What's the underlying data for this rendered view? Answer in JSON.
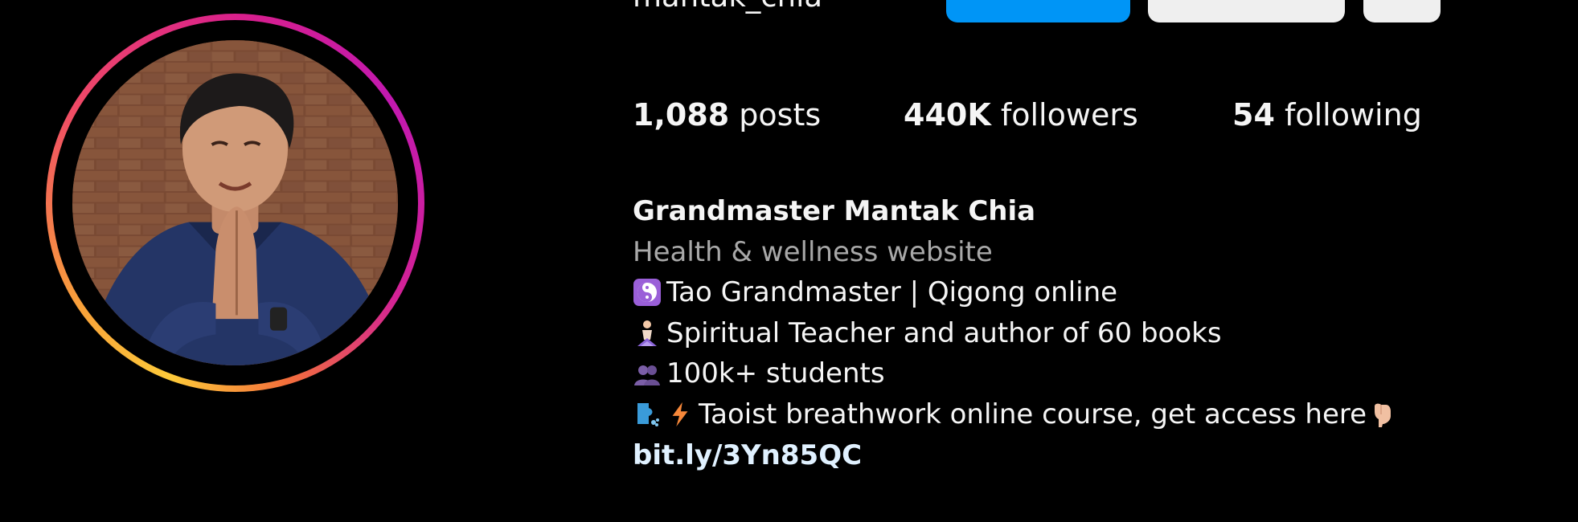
{
  "profile": {
    "username": "mantak_chia",
    "buttons": {
      "follow": "",
      "message": "",
      "more": ""
    },
    "stats": {
      "posts_count": "1,088",
      "posts_label": "posts",
      "followers_count": "440K",
      "followers_label": "followers",
      "following_count": "54",
      "following_label": "following"
    },
    "bio": {
      "full_name": "Grandmaster Mantak Chia",
      "category": "Health & wellness website",
      "lines": [
        {
          "icon": "yin-yang-icon",
          "text": "Tao Grandmaster | Qigong online"
        },
        {
          "icon": "person-in-lotus-position-icon",
          "text": "Spiritual Teacher and author of 60 books"
        },
        {
          "icon": "busts-in-silhouette-icon",
          "text": "100k+ students"
        },
        {
          "icon": "face-exhaling-icon",
          "icon2": "high-voltage-icon",
          "text": "Taoist breathwork online course, get access here",
          "trailing_icon": "backhand-index-pointing-down-icon"
        }
      ],
      "link": "bit.ly/3Yn85QC"
    }
  },
  "colors": {
    "background": "#000000",
    "text": "#f5f5f5",
    "secondary_text": "#a8a8a8",
    "link": "#e0f1ff",
    "follow_button": "#0095f6",
    "secondary_button": "#efefef"
  }
}
